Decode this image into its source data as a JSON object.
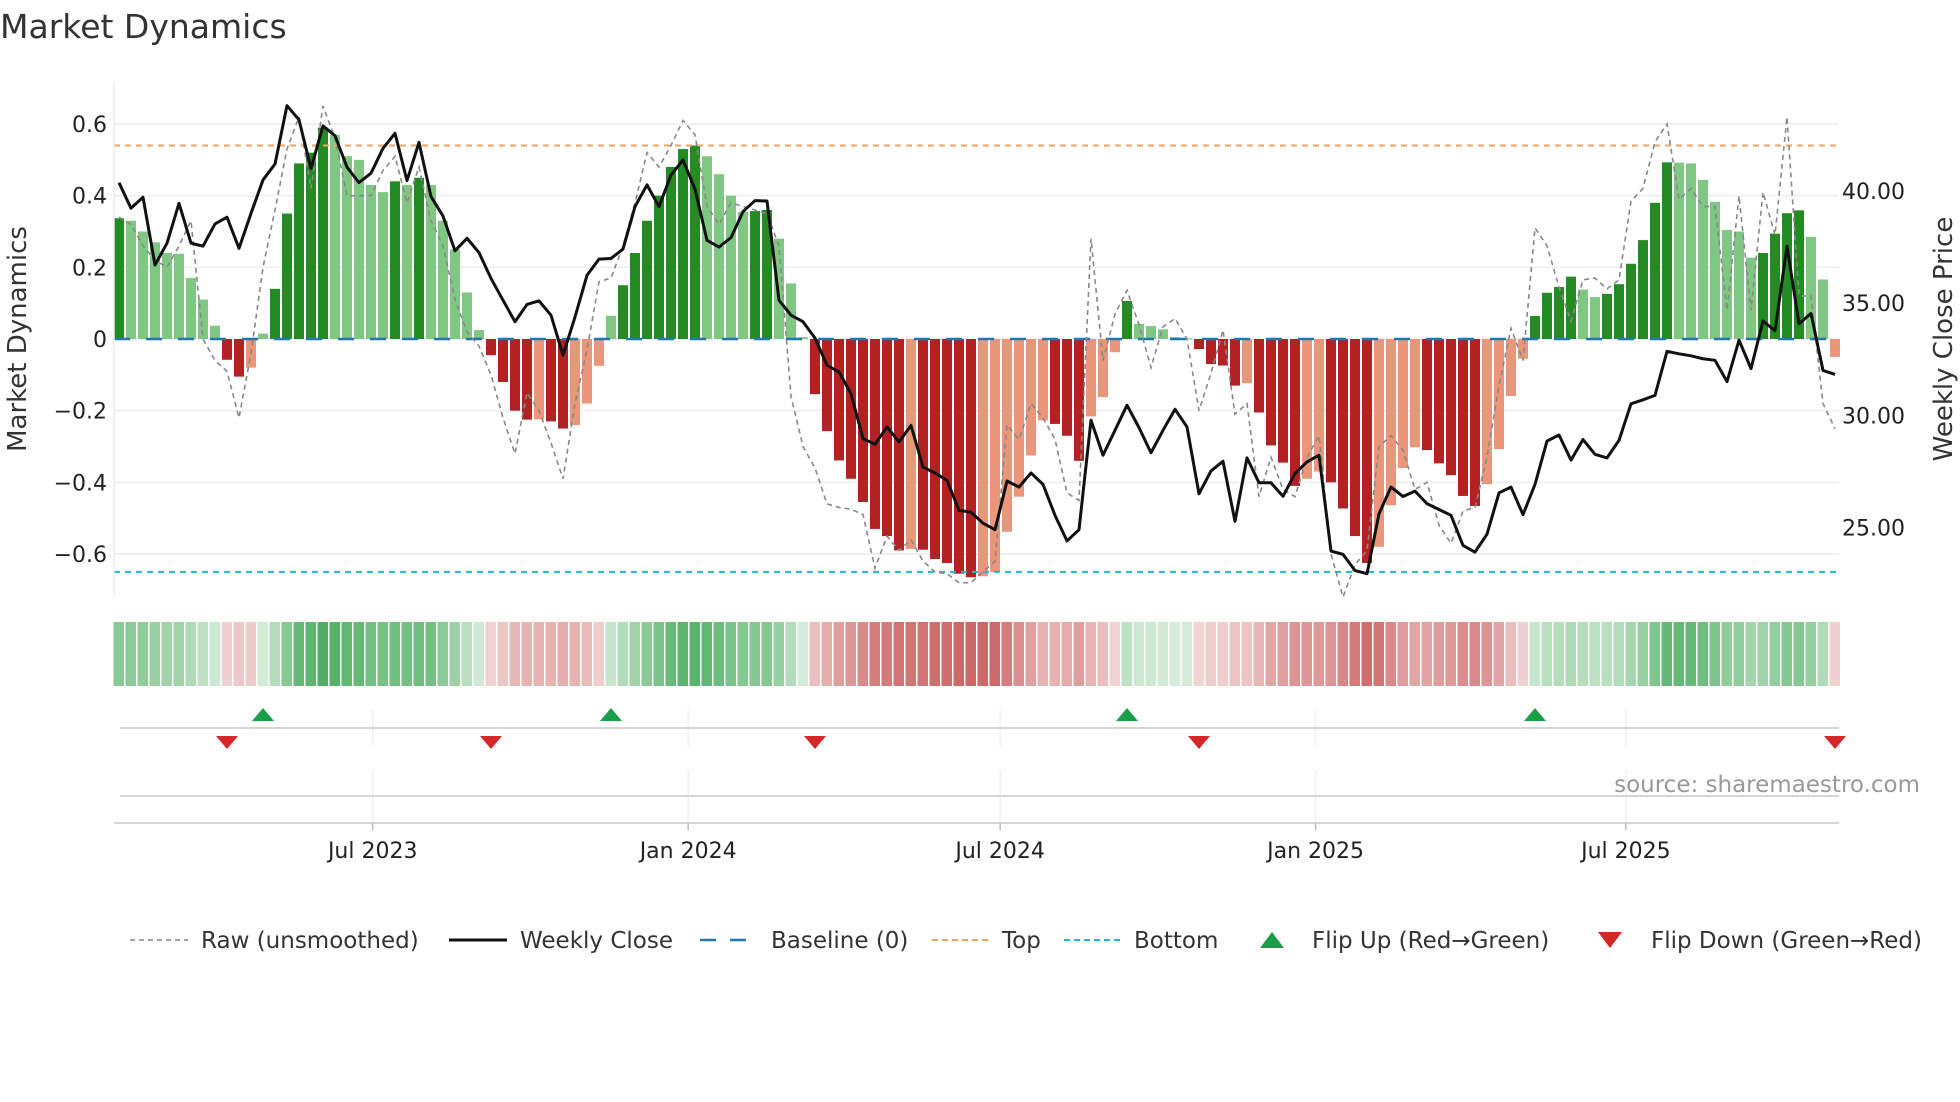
{
  "chart_data": {
    "type": "bar",
    "title": "Market Dynamics",
    "ylabel": "Market Dynamics",
    "ylabel_right": "Weekly Close Price",
    "source": "source: sharemaestro.com",
    "x_start": "2023-02-03",
    "x_frequency": "weekly",
    "ylim": [
      -0.72,
      0.72
    ],
    "ylim_right": [
      21.9,
      44.9
    ],
    "yticks": [
      -0.6,
      -0.4,
      -0.2,
      0,
      0.2,
      0.4,
      0.6
    ],
    "ytick_labels": [
      "−0.6",
      "−0.4",
      "−0.2",
      "0",
      "0.2",
      "0.4",
      "0.6"
    ],
    "yticks_right": [
      25,
      30,
      35,
      40
    ],
    "ytick_labels_right": [
      "25.00",
      "30.00",
      "35.00",
      "40.00"
    ],
    "xticks": [
      {
        "date": "2023-07-01",
        "label": "Jul 2023"
      },
      {
        "date": "2024-01-01",
        "label": "Jan 2024"
      },
      {
        "date": "2024-07-01",
        "label": "Jul 2024"
      },
      {
        "date": "2025-01-01",
        "label": "Jan 2025"
      },
      {
        "date": "2025-07-01",
        "label": "Jul 2025"
      }
    ],
    "grid": true,
    "thresholds": {
      "top": 0.54,
      "bottom": -0.65,
      "baseline": 0
    },
    "colors": {
      "green_strong": "#228b22",
      "green_weak": "#81c784",
      "red_strong": "#b22222",
      "red_weak": "#e9967a",
      "raw": "#888888",
      "close": "#111111",
      "baseline": "#1f77b4",
      "top": "#f4a261",
      "bottom": "#17becf",
      "flip_up": "#1a9e4a",
      "flip_down": "#d62728"
    },
    "series": [
      {
        "name": "Market Dynamics (smoothed)",
        "values": [
          0.337,
          0.33,
          0.3,
          0.27,
          0.24,
          0.238,
          0.17,
          0.11,
          0.037,
          -0.058,
          -0.105,
          -0.08,
          0.015,
          0.14,
          0.35,
          0.49,
          0.52,
          0.59,
          0.57,
          0.51,
          0.5,
          0.43,
          0.41,
          0.44,
          0.43,
          0.45,
          0.43,
          0.33,
          0.25,
          0.13,
          0.025,
          -0.045,
          -0.12,
          -0.2,
          -0.225,
          -0.224,
          -0.23,
          -0.25,
          -0.24,
          -0.18,
          -0.075,
          0.065,
          0.15,
          0.24,
          0.33,
          0.4,
          0.48,
          0.53,
          0.54,
          0.51,
          0.46,
          0.4,
          0.355,
          0.357,
          0.36,
          0.28,
          0.155,
          0.005,
          -0.154,
          -0.257,
          -0.339,
          -0.39,
          -0.455,
          -0.53,
          -0.55,
          -0.59,
          -0.586,
          -0.588,
          -0.614,
          -0.625,
          -0.655,
          -0.665,
          -0.662,
          -0.65,
          -0.538,
          -0.44,
          -0.325,
          -0.227,
          -0.237,
          -0.27,
          -0.34,
          -0.216,
          -0.162,
          -0.037,
          0.106,
          0.042,
          0.036,
          0.027,
          0.005,
          0.002,
          -0.028,
          -0.07,
          -0.074,
          -0.13,
          -0.123,
          -0.205,
          -0.297,
          -0.345,
          -0.41,
          -0.39,
          -0.37,
          -0.4,
          -0.473,
          -0.55,
          -0.625,
          -0.58,
          -0.464,
          -0.36,
          -0.302,
          -0.31,
          -0.347,
          -0.38,
          -0.438,
          -0.466,
          -0.405,
          -0.307,
          -0.159,
          -0.055,
          0.064,
          0.129,
          0.145,
          0.174,
          0.138,
          0.117,
          0.126,
          0.153,
          0.21,
          0.276,
          0.38,
          0.493,
          0.492,
          0.49,
          0.444,
          0.383,
          0.304,
          0.3,
          0.227,
          0.24,
          0.294,
          0.351,
          0.359,
          0.285,
          0.166,
          -0.05
        ]
      },
      {
        "name": "Raw (unsmoothed)",
        "values": [
          0.34,
          0.32,
          0.26,
          0.22,
          0.2,
          0.26,
          0.33,
          0.0,
          -0.06,
          -0.09,
          -0.22,
          -0.04,
          0.2,
          0.36,
          0.53,
          0.62,
          0.42,
          0.65,
          0.56,
          0.4,
          0.4,
          0.4,
          0.47,
          0.51,
          0.38,
          0.48,
          0.33,
          0.26,
          0.11,
          0.02,
          -0.02,
          -0.1,
          -0.22,
          -0.32,
          -0.15,
          -0.2,
          -0.29,
          -0.39,
          -0.18,
          -0.03,
          0.16,
          0.17,
          0.26,
          0.38,
          0.52,
          0.48,
          0.54,
          0.61,
          0.57,
          0.37,
          0.32,
          0.38,
          0.37,
          0.36,
          0.35,
          0.26,
          -0.16,
          -0.3,
          -0.36,
          -0.46,
          -0.47,
          -0.475,
          -0.49,
          -0.64,
          -0.55,
          -0.59,
          -0.56,
          -0.62,
          -0.65,
          -0.655,
          -0.68,
          -0.68,
          -0.65,
          -0.62,
          -0.24,
          -0.28,
          -0.18,
          -0.22,
          -0.28,
          -0.43,
          -0.45,
          0.28,
          -0.06,
          0.07,
          0.136,
          0.04,
          -0.08,
          0.034,
          0.057,
          0.0,
          -0.2,
          -0.095,
          0.025,
          -0.21,
          -0.18,
          -0.44,
          -0.33,
          -0.42,
          -0.44,
          -0.33,
          -0.27,
          -0.6,
          -0.72,
          -0.63,
          -0.59,
          -0.3,
          -0.27,
          -0.31,
          -0.42,
          -0.4,
          -0.52,
          -0.57,
          -0.48,
          -0.47,
          -0.33,
          -0.13,
          0.03,
          -0.06,
          0.31,
          0.26,
          0.145,
          0.05,
          0.165,
          0.17,
          0.14,
          0.165,
          0.385,
          0.42,
          0.55,
          0.6,
          0.39,
          0.42,
          0.37,
          0.37,
          0.08,
          0.4,
          0.08,
          0.41,
          0.29,
          0.62,
          0.12,
          0.12,
          -0.18,
          -0.25
        ]
      },
      {
        "name": "Weekly Close",
        "axis": "right",
        "values": [
          40.37,
          39.23,
          39.72,
          36.7,
          37.67,
          39.45,
          37.67,
          37.54,
          38.53,
          38.83,
          37.44,
          39.0,
          40.49,
          41.2,
          43.8,
          43.17,
          41.0,
          42.9,
          42.46,
          41.06,
          40.37,
          40.79,
          41.9,
          42.57,
          40.46,
          42.16,
          39.75,
          38.88,
          37.33,
          37.89,
          37.25,
          36.1,
          35.13,
          34.17,
          34.94,
          35.1,
          34.46,
          32.68,
          34.38,
          36.24,
          36.96,
          36.99,
          37.41,
          39.3,
          40.27,
          39.3,
          40.71,
          41.38,
          40.08,
          37.8,
          37.5,
          37.92,
          39.08,
          39.57,
          39.55,
          35.13,
          34.46,
          34.17,
          33.44,
          32.23,
          31.93,
          30.96,
          28.96,
          28.71,
          29.48,
          28.81,
          29.55,
          27.69,
          27.43,
          27.1,
          25.76,
          25.68,
          25.19,
          24.9,
          27.07,
          26.8,
          27.43,
          26.92,
          25.54,
          24.4,
          24.9,
          29.78,
          28.22,
          29.33,
          30.45,
          29.45,
          28.33,
          29.33,
          30.27,
          29.48,
          26.5,
          27.52,
          27.95,
          25.27,
          28.1,
          26.99,
          26.99,
          26.39,
          27.4,
          27.92,
          28.22,
          23.95,
          23.8,
          23.08,
          22.94,
          25.61,
          26.8,
          26.38,
          26.62,
          26.06,
          25.8,
          25.54,
          24.2,
          23.9,
          24.7,
          26.54,
          26.8,
          25.57,
          26.92,
          28.85,
          29.12,
          28.0,
          28.92,
          28.26,
          28.1,
          28.88,
          30.51,
          30.69,
          30.89,
          32.85,
          32.74,
          32.65,
          32.52,
          32.45,
          31.5,
          33.35,
          32.08,
          34.2,
          33.77,
          37.54,
          34.08,
          34.54,
          32.0,
          31.82
        ]
      }
    ],
    "flips": {
      "up": [
        "2023-04-28",
        "2023-11-17",
        "2024-09-13",
        "2025-05-09"
      ],
      "down": [
        "2023-04-07",
        "2023-09-08",
        "2024-03-15",
        "2024-10-25",
        "2025-10-31"
      ]
    },
    "legend": {
      "position": "bottom",
      "items": [
        {
          "key": "raw",
          "label": "Raw (unsmoothed)"
        },
        {
          "key": "close",
          "label": "Weekly Close"
        },
        {
          "key": "baseline",
          "label": "Baseline (0)"
        },
        {
          "key": "top",
          "label": "Top"
        },
        {
          "key": "bottom",
          "label": "Bottom"
        },
        {
          "key": "flip_up",
          "label": "Flip Up (Red→Green)"
        },
        {
          "key": "flip_down",
          "label": "Flip Down (Green→Red)"
        }
      ]
    }
  }
}
